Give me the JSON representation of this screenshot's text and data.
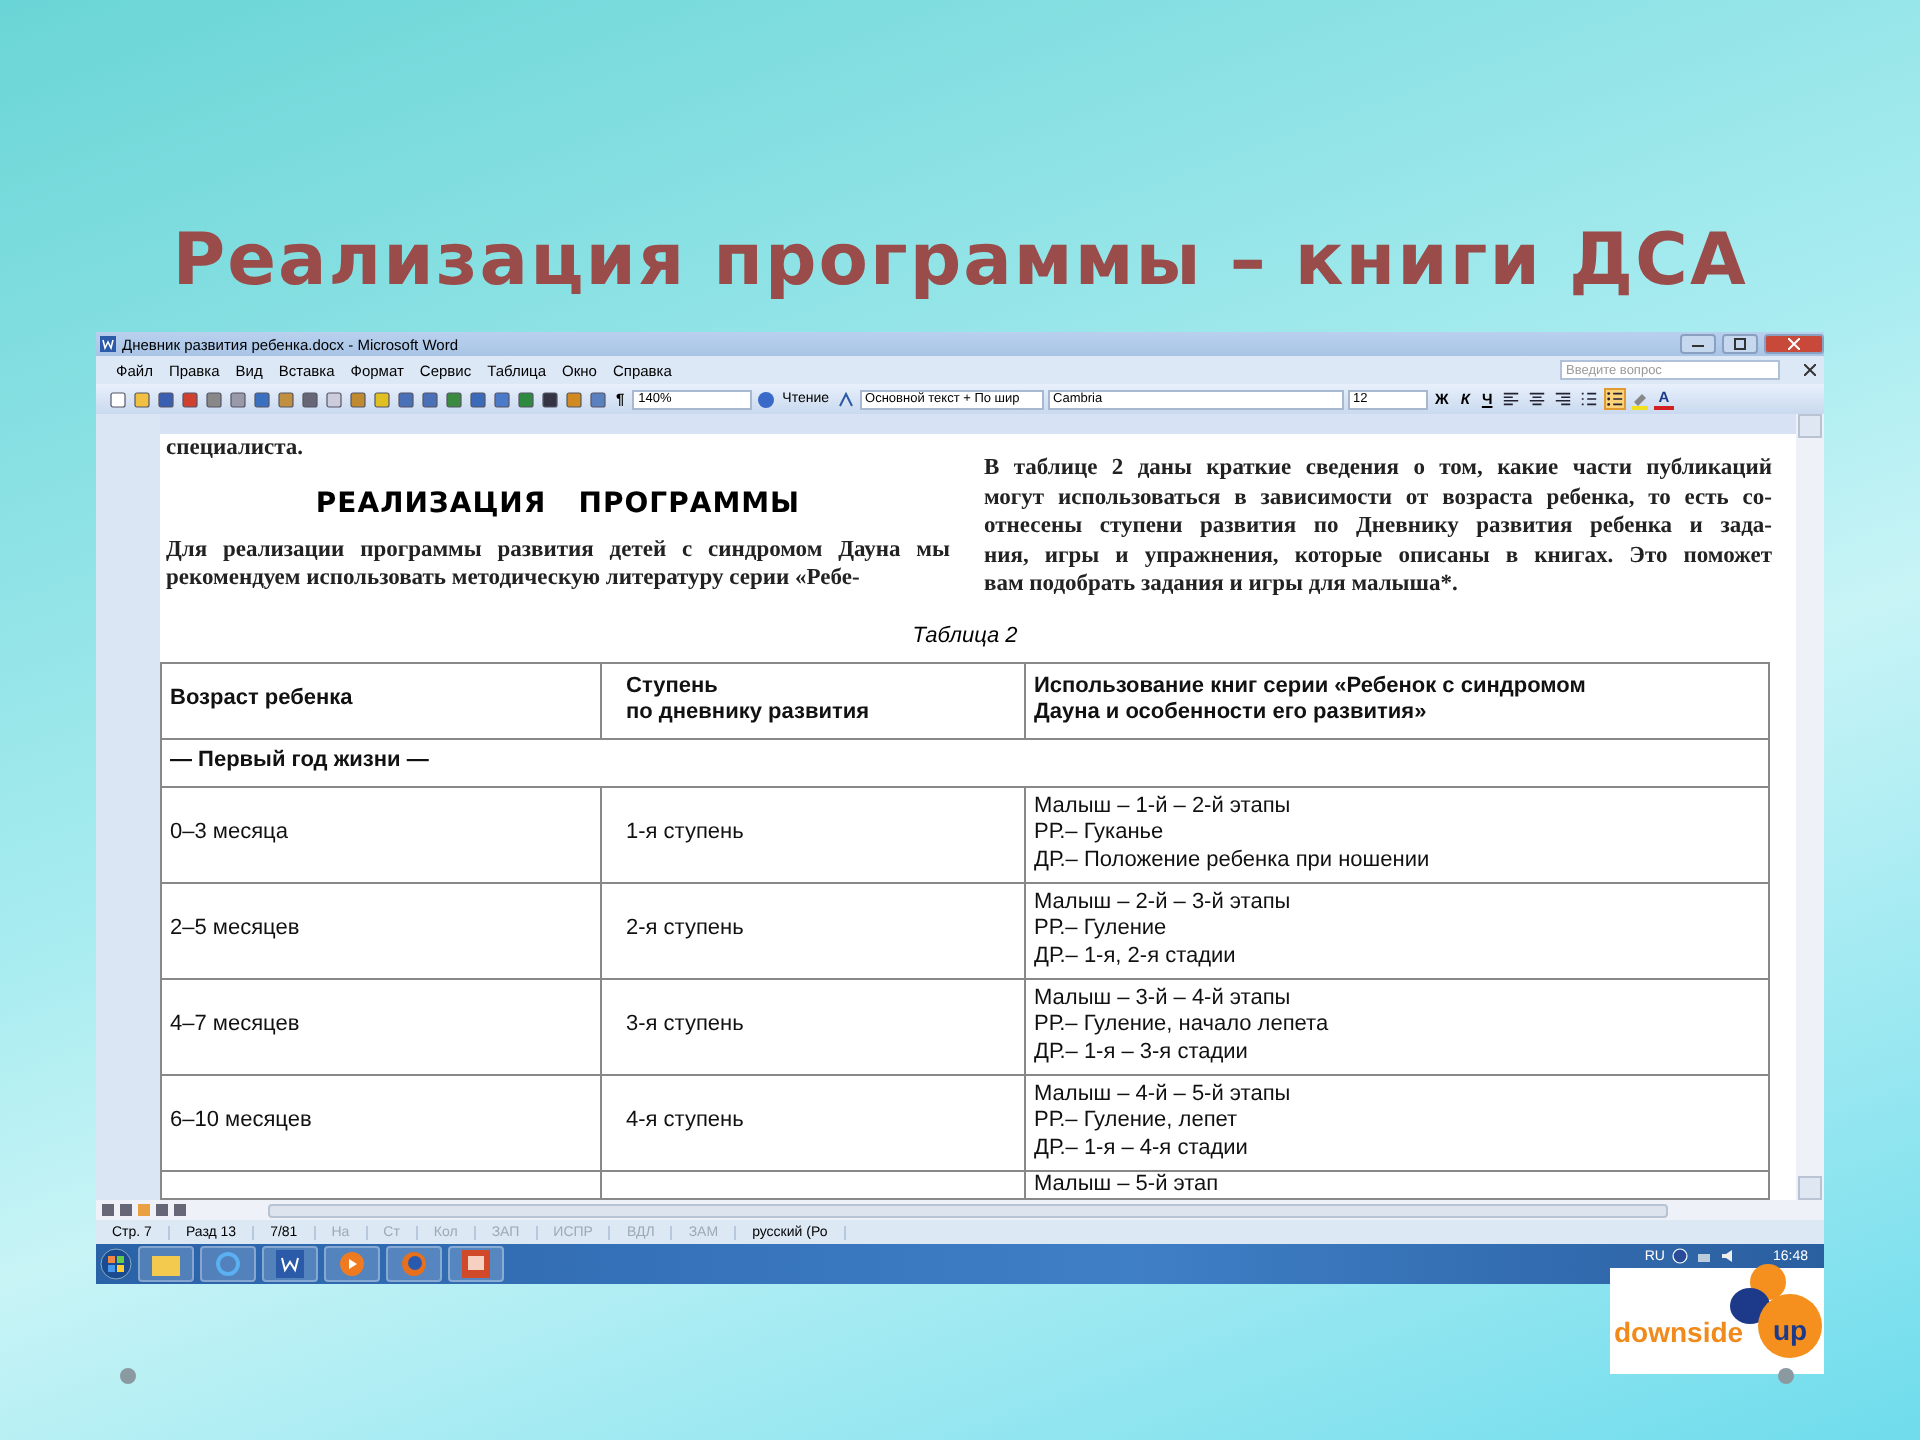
{
  "slide": {
    "title": "Реализация программы – книги ДСА"
  },
  "window": {
    "title": "Дневник развития ребенка.docx - Microsoft Word",
    "help_placeholder": "Введите вопрос"
  },
  "menu": [
    "Файл",
    "Правка",
    "Вид",
    "Вставка",
    "Формат",
    "Сервис",
    "Таблица",
    "Окно",
    "Справка"
  ],
  "toolbar": {
    "pilcrow": "¶",
    "zoom": "140%",
    "reading": "Чтение",
    "style": "Основной текст + По шир",
    "font": "Cambria",
    "size": "12",
    "bold": "Ж",
    "italic": "К",
    "underline": "Ч",
    "font_color": "A",
    "paragraph_buttons": [
      {
        "kind": "align-left",
        "selected": false
      },
      {
        "kind": "align-center",
        "selected": false
      },
      {
        "kind": "align-right",
        "selected": false
      },
      {
        "kind": "numbering",
        "selected": false
      },
      {
        "kind": "bullets",
        "selected": true
      }
    ]
  },
  "document": {
    "top_text": "специалиста.",
    "heading": "РЕАЛИЗАЦИЯ   ПРОГРАММЫ",
    "left_paragraph": [
      "Для реализации программы развития детей с синдромом Дауна мы",
      "рекомендуем использовать методическую литературу серии «Ребе-"
    ],
    "right_paragraph": [
      "В таблице 2 даны краткие сведения о том, какие части публикаций",
      "могут использоваться в зависимости от возраста ребенка, то есть со-",
      "отнесены ступени развития по Дневнику развития ребенка и зада-",
      "ния, игры и упражнения, которые описаны в книгах. Это поможет",
      "вам подобрать задания и игры для малыша*."
    ],
    "table_caption": "Таблица 2",
    "table": {
      "columns": [
        [
          "Возраст ребенка"
        ],
        [
          "Ступень",
          "по дневнику развития"
        ],
        [
          "Использование книг серии «Ребенок с синдромом",
          "Дауна и особенности его развития»"
        ]
      ],
      "section": "— Первый год жизни —",
      "rows": [
        {
          "age": "0–3 месяца",
          "stage": "1-я ступень",
          "books": [
            "Малыш – 1-й – 2-й этапы",
            "РР.– Гуканье",
            "ДР.– Положение ребенка при ношении"
          ]
        },
        {
          "age": "2–5 месяцев",
          "stage": "2-я ступень",
          "books": [
            "Малыш – 2-й – 3-й этапы",
            "РР.– Гуление",
            "ДР.– 1-я, 2-я стадии"
          ]
        },
        {
          "age": "4–7 месяцев",
          "stage": "3-я ступень",
          "books": [
            "Малыш – 3-й – 4-й этапы",
            "РР.– Гуление, начало лепета",
            "ДР.– 1-я – 3-я стадии"
          ]
        },
        {
          "age": "6–10 месяцев",
          "stage": "4-я ступень",
          "books": [
            "Малыш – 4-й – 5-й этапы",
            "РР.– Гуление, лепет",
            "ДР.– 1-я – 4-я стадии"
          ]
        },
        {
          "books": [
            "Малыш – 5-й этап"
          ]
        }
      ]
    }
  },
  "status_bar": [
    {
      "text": "Стр. 7",
      "disabled": false
    },
    {
      "text": "Разд 13",
      "disabled": false
    },
    {
      "text": "7/81",
      "disabled": false
    },
    {
      "text": "На",
      "disabled": true
    },
    {
      "text": "Ст",
      "disabled": true
    },
    {
      "text": "Кол",
      "disabled": true
    },
    {
      "text": "ЗАП",
      "disabled": true
    },
    {
      "text": "ИСПР",
      "disabled": true
    },
    {
      "text": "ВДЛ",
      "disabled": true
    },
    {
      "text": "ЗАМ",
      "disabled": true
    },
    {
      "text": "русский (Ро",
      "disabled": false
    }
  ],
  "taskbar": {
    "language": "RU",
    "time": "16:48"
  },
  "logo": {
    "word": "downside",
    "badge": "up"
  }
}
